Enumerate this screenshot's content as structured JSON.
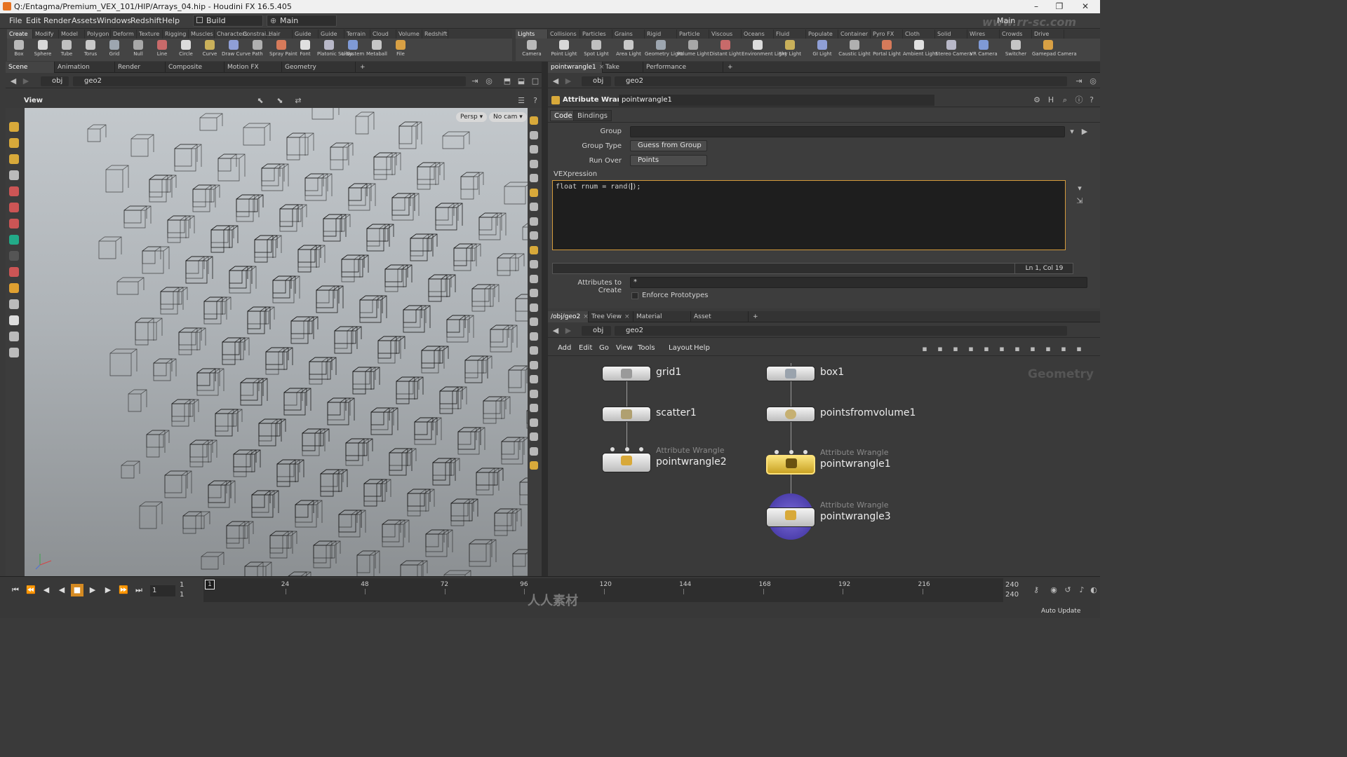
{
  "window": {
    "title": "Q:/Entagma/Premium_VEX_101/HIP/Arrays_04.hip - Houdini FX 16.5.405",
    "controls": [
      "–",
      "❐",
      "✕"
    ]
  },
  "menubar": {
    "items": [
      "File",
      "Edit",
      "Render",
      "Assets",
      "Windows",
      "Redshift",
      "Help"
    ],
    "desktop_selector": "Build",
    "network_selector": "Main",
    "right_selector": "Main"
  },
  "shelf_left": {
    "tabs": [
      "Create",
      "Modify",
      "Model",
      "Polygon",
      "Deform",
      "Texture",
      "Rigging",
      "Muscles",
      "Characters",
      "Constrai...",
      "Hair Utils",
      "Guide Pr...",
      "Guide Br...",
      "Terrain FX",
      "Cloud FX",
      "Volume",
      "Redshift"
    ],
    "tools": [
      "Box",
      "Sphere",
      "Tube",
      "Torus",
      "Grid",
      "Null",
      "Line",
      "Circle",
      "Curve",
      "Draw Curve",
      "Path",
      "Spray Paint",
      "Font",
      "Platonic Solids",
      "L-System",
      "Metaball",
      "File"
    ]
  },
  "shelf_right": {
    "tabs": [
      "Lights and C...",
      "Collisions",
      "Particles",
      "Grains",
      "Rigid Bodies",
      "Particle Fluids",
      "Viscous Fluids",
      "Oceans",
      "Fluid Contai...",
      "Populate Con...",
      "Container Tools",
      "Pyro FX",
      "Cloth",
      "Solid",
      "Wires",
      "Crowds",
      "Drive Simula..."
    ],
    "tools": [
      "Camera",
      "Point Light",
      "Spot Light",
      "Area Light",
      "Geometry Light",
      "Volume Light",
      "Distant Light",
      "Environment Light",
      "Sky Light",
      "GI Light",
      "Caustic Light",
      "Portal Light",
      "Ambient Light",
      "Stereo Camera",
      "VR Camera",
      "Switcher",
      "Gamepad Camera"
    ]
  },
  "left_pane": {
    "tabs": [
      "Scene View",
      "Animation Editor",
      "Render View",
      "Composite View",
      "Motion FX View",
      "Geometry Spreadsheet"
    ],
    "path": [
      "obj",
      "geo2"
    ],
    "view_label": "View",
    "persp_button": "Persp ▾",
    "cam_button": "No cam ▾"
  },
  "param_pane": {
    "tabs": [
      "pointwrangle1",
      "Take List",
      "Performance Monitor"
    ],
    "path": [
      "obj",
      "geo2"
    ],
    "node_type": "Attribute Wrangle",
    "node_name": "pointwrangle1",
    "subtabs": [
      "Code",
      "Bindings"
    ],
    "group_label": "Group",
    "group_value": "",
    "group_type_label": "Group Type",
    "group_type_value": "Guess from Group",
    "run_over_label": "Run Over",
    "run_over_value": "Points",
    "vex_label": "VEXpression",
    "vex_code_prefix": "float rnum = rand(",
    "vex_code_suffix": ");",
    "cursor_pos": "Ln 1, Col 19",
    "attrs_label": "Attributes to Create",
    "attrs_value": "*",
    "enforce_label": "Enforce Prototypes"
  },
  "network_pane": {
    "tabs": [
      "/obj/geo2",
      "Tree View",
      "Material Palette",
      "Asset Browser"
    ],
    "path": [
      "obj",
      "geo2"
    ],
    "menu": [
      "Add",
      "Edit",
      "Go",
      "View",
      "Tools",
      "Layout",
      "Help"
    ],
    "context_label": "Geometry",
    "nodes": {
      "grid1": {
        "name": "grid1"
      },
      "scatter1": {
        "name": "scatter1"
      },
      "pointwrangle2": {
        "type": "Attribute Wrangle",
        "name": "pointwrangle2"
      },
      "box1": {
        "name": "box1"
      },
      "pointsfromvolume1": {
        "name": "pointsfromvolume1"
      },
      "pointwrangle1": {
        "type": "Attribute Wrangle",
        "name": "pointwrangle1"
      },
      "pointwrangle3": {
        "type": "Attribute Wrangle",
        "name": "pointwrangle3"
      }
    }
  },
  "timeline": {
    "current_frame": "1",
    "start_frame": "1",
    "range_start": "1",
    "range_start2": "1",
    "ticks": [
      "24",
      "48",
      "72",
      "96",
      "120",
      "144",
      "168",
      "192",
      "216"
    ],
    "range_end": "240",
    "range_end2": "240",
    "auto_update": "Auto Update"
  },
  "watermark": {
    "site": "www.rr-sc.com",
    "logo_text": "人人素材"
  }
}
